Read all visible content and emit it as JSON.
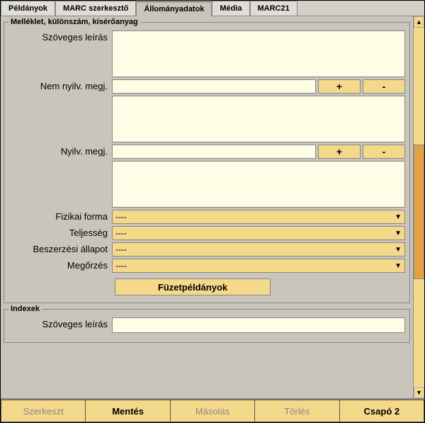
{
  "tabs": [
    "Példányok",
    "MARC szerkesztő",
    "Állományadatok",
    "Média",
    "MARC21"
  ],
  "active_tab": "Állományadatok",
  "fieldset1_legend": "Melléklet, különszám, kísérőanyag",
  "labels": {
    "szoveges": "Szöveges leírás",
    "nem_nyilv": "Nem nyilv. megj.",
    "nyilv": "Nyilv. megj.",
    "fizikai": "Fizikai forma",
    "teljesseg": "Teljesség",
    "beszerz": "Beszerzési állapot",
    "megorzes": "Megőrzés"
  },
  "values": {
    "szoveges": "",
    "nem_nyilv": "",
    "nem_nyilv_area": "",
    "nyilv": "",
    "nyilv_area": "",
    "fizikai": "----",
    "teljesseg": "----",
    "beszerz": "----",
    "megorzes": "----",
    "index_szoveges": ""
  },
  "buttons": {
    "plus": "+",
    "minus": "-",
    "fuzet": "Füzetpéldányok"
  },
  "fieldset2_legend": "Indexek",
  "bottom": [
    "Szerkeszt",
    "Mentés",
    "Másolás",
    "Törlés",
    "Csapó 2"
  ]
}
